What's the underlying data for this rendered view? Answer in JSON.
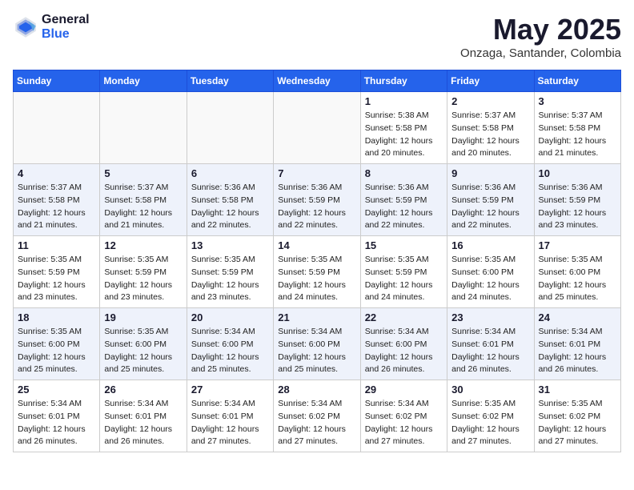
{
  "header": {
    "logo_general": "General",
    "logo_blue": "Blue",
    "month_title": "May 2025",
    "location": "Onzaga, Santander, Colombia"
  },
  "days_of_week": [
    "Sunday",
    "Monday",
    "Tuesday",
    "Wednesday",
    "Thursday",
    "Friday",
    "Saturday"
  ],
  "weeks": [
    [
      {
        "num": "",
        "info": "",
        "empty": true
      },
      {
        "num": "",
        "info": "",
        "empty": true
      },
      {
        "num": "",
        "info": "",
        "empty": true
      },
      {
        "num": "",
        "info": "",
        "empty": true
      },
      {
        "num": "1",
        "info": "Sunrise: 5:38 AM\nSunset: 5:58 PM\nDaylight: 12 hours\nand 20 minutes.",
        "empty": false
      },
      {
        "num": "2",
        "info": "Sunrise: 5:37 AM\nSunset: 5:58 PM\nDaylight: 12 hours\nand 20 minutes.",
        "empty": false
      },
      {
        "num": "3",
        "info": "Sunrise: 5:37 AM\nSunset: 5:58 PM\nDaylight: 12 hours\nand 21 minutes.",
        "empty": false
      }
    ],
    [
      {
        "num": "4",
        "info": "Sunrise: 5:37 AM\nSunset: 5:58 PM\nDaylight: 12 hours\nand 21 minutes.",
        "empty": false
      },
      {
        "num": "5",
        "info": "Sunrise: 5:37 AM\nSunset: 5:58 PM\nDaylight: 12 hours\nand 21 minutes.",
        "empty": false
      },
      {
        "num": "6",
        "info": "Sunrise: 5:36 AM\nSunset: 5:58 PM\nDaylight: 12 hours\nand 22 minutes.",
        "empty": false
      },
      {
        "num": "7",
        "info": "Sunrise: 5:36 AM\nSunset: 5:59 PM\nDaylight: 12 hours\nand 22 minutes.",
        "empty": false
      },
      {
        "num": "8",
        "info": "Sunrise: 5:36 AM\nSunset: 5:59 PM\nDaylight: 12 hours\nand 22 minutes.",
        "empty": false
      },
      {
        "num": "9",
        "info": "Sunrise: 5:36 AM\nSunset: 5:59 PM\nDaylight: 12 hours\nand 22 minutes.",
        "empty": false
      },
      {
        "num": "10",
        "info": "Sunrise: 5:36 AM\nSunset: 5:59 PM\nDaylight: 12 hours\nand 23 minutes.",
        "empty": false
      }
    ],
    [
      {
        "num": "11",
        "info": "Sunrise: 5:35 AM\nSunset: 5:59 PM\nDaylight: 12 hours\nand 23 minutes.",
        "empty": false
      },
      {
        "num": "12",
        "info": "Sunrise: 5:35 AM\nSunset: 5:59 PM\nDaylight: 12 hours\nand 23 minutes.",
        "empty": false
      },
      {
        "num": "13",
        "info": "Sunrise: 5:35 AM\nSunset: 5:59 PM\nDaylight: 12 hours\nand 23 minutes.",
        "empty": false
      },
      {
        "num": "14",
        "info": "Sunrise: 5:35 AM\nSunset: 5:59 PM\nDaylight: 12 hours\nand 24 minutes.",
        "empty": false
      },
      {
        "num": "15",
        "info": "Sunrise: 5:35 AM\nSunset: 5:59 PM\nDaylight: 12 hours\nand 24 minutes.",
        "empty": false
      },
      {
        "num": "16",
        "info": "Sunrise: 5:35 AM\nSunset: 6:00 PM\nDaylight: 12 hours\nand 24 minutes.",
        "empty": false
      },
      {
        "num": "17",
        "info": "Sunrise: 5:35 AM\nSunset: 6:00 PM\nDaylight: 12 hours\nand 25 minutes.",
        "empty": false
      }
    ],
    [
      {
        "num": "18",
        "info": "Sunrise: 5:35 AM\nSunset: 6:00 PM\nDaylight: 12 hours\nand 25 minutes.",
        "empty": false
      },
      {
        "num": "19",
        "info": "Sunrise: 5:35 AM\nSunset: 6:00 PM\nDaylight: 12 hours\nand 25 minutes.",
        "empty": false
      },
      {
        "num": "20",
        "info": "Sunrise: 5:34 AM\nSunset: 6:00 PM\nDaylight: 12 hours\nand 25 minutes.",
        "empty": false
      },
      {
        "num": "21",
        "info": "Sunrise: 5:34 AM\nSunset: 6:00 PM\nDaylight: 12 hours\nand 25 minutes.",
        "empty": false
      },
      {
        "num": "22",
        "info": "Sunrise: 5:34 AM\nSunset: 6:00 PM\nDaylight: 12 hours\nand 26 minutes.",
        "empty": false
      },
      {
        "num": "23",
        "info": "Sunrise: 5:34 AM\nSunset: 6:01 PM\nDaylight: 12 hours\nand 26 minutes.",
        "empty": false
      },
      {
        "num": "24",
        "info": "Sunrise: 5:34 AM\nSunset: 6:01 PM\nDaylight: 12 hours\nand 26 minutes.",
        "empty": false
      }
    ],
    [
      {
        "num": "25",
        "info": "Sunrise: 5:34 AM\nSunset: 6:01 PM\nDaylight: 12 hours\nand 26 minutes.",
        "empty": false
      },
      {
        "num": "26",
        "info": "Sunrise: 5:34 AM\nSunset: 6:01 PM\nDaylight: 12 hours\nand 26 minutes.",
        "empty": false
      },
      {
        "num": "27",
        "info": "Sunrise: 5:34 AM\nSunset: 6:01 PM\nDaylight: 12 hours\nand 27 minutes.",
        "empty": false
      },
      {
        "num": "28",
        "info": "Sunrise: 5:34 AM\nSunset: 6:02 PM\nDaylight: 12 hours\nand 27 minutes.",
        "empty": false
      },
      {
        "num": "29",
        "info": "Sunrise: 5:34 AM\nSunset: 6:02 PM\nDaylight: 12 hours\nand 27 minutes.",
        "empty": false
      },
      {
        "num": "30",
        "info": "Sunrise: 5:35 AM\nSunset: 6:02 PM\nDaylight: 12 hours\nand 27 minutes.",
        "empty": false
      },
      {
        "num": "31",
        "info": "Sunrise: 5:35 AM\nSunset: 6:02 PM\nDaylight: 12 hours\nand 27 minutes.",
        "empty": false
      }
    ]
  ]
}
